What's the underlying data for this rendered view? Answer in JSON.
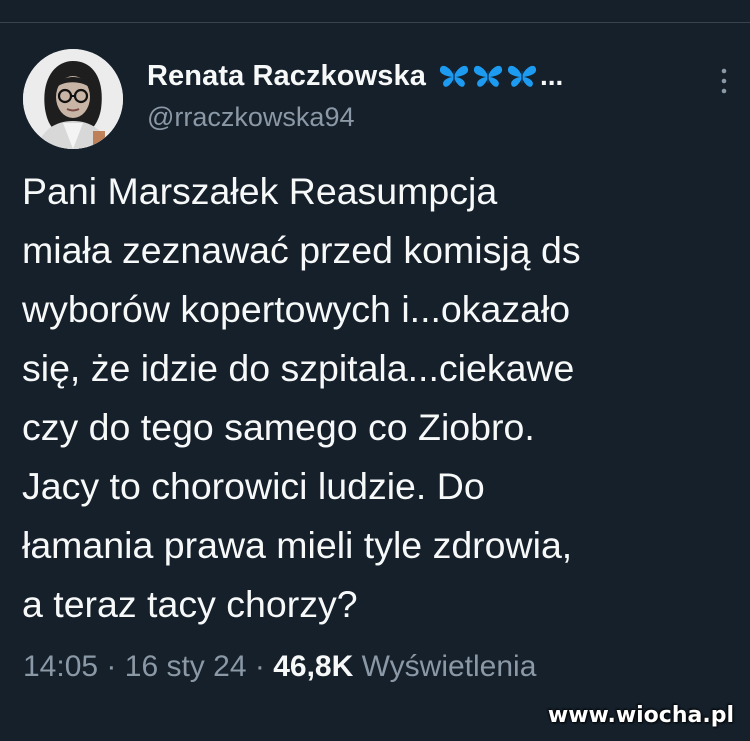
{
  "tweet": {
    "author": {
      "display_name": "Renata Raczkowska",
      "name_emoji": "butterfly-icon",
      "name_emoji_count": 3,
      "name_truncation": "...",
      "handle": "@rraczkowska94"
    },
    "text": "Pani Marszałek Reasumpcja\nmiała zeznawać przed komisją ds\nwyborów kopertowych i...okazało\nsię, że idzie do szpitala...ciekawe\nczy do tego samego co Ziobro.\nJacy to chorowici ludzie. Do\nłamania prawa mieli tyle zdrowia,\na teraz tacy chorzy?",
    "meta": {
      "time": "14:05",
      "separator": "·",
      "date": "16 sty 24",
      "views_count": "46,8K",
      "views_label": "Wyświetlenia"
    }
  },
  "watermark": "www.wiocha.pl",
  "colors": {
    "background": "#15202b",
    "text_primary": "#f7f9f9",
    "text_secondary": "#8b98a5",
    "butterfly": "#1d9bf0"
  }
}
